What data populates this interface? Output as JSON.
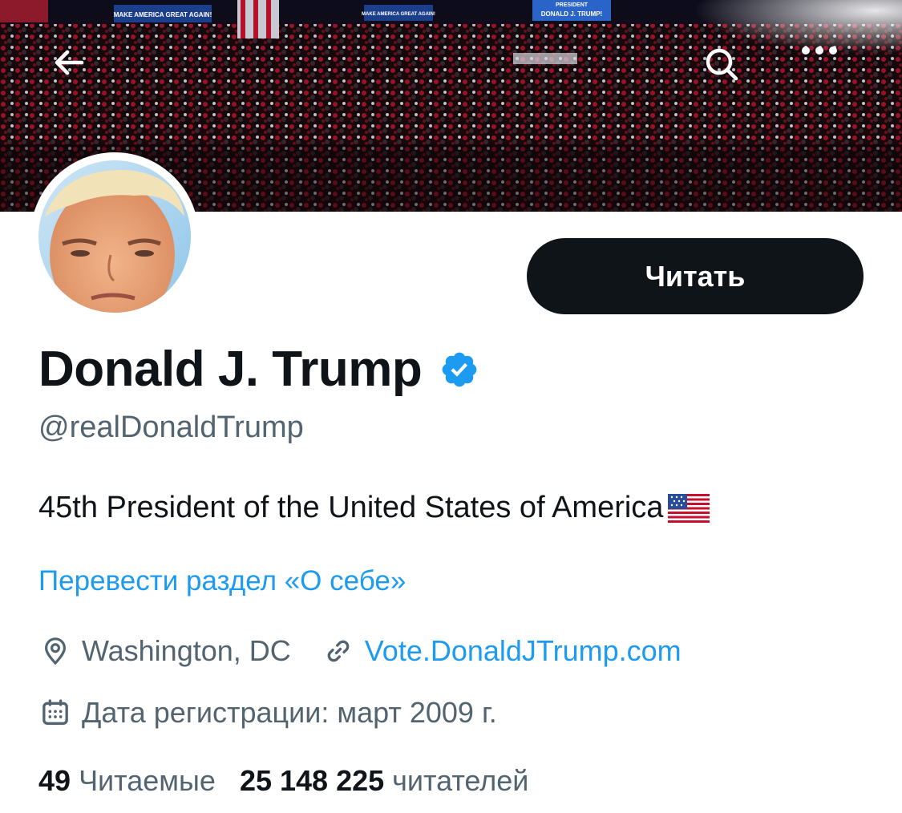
{
  "header": {
    "back_icon": "arrow-left-icon",
    "search_icon": "search-icon",
    "more_icon": "more-horizontal-icon",
    "banner_signs": [
      "MAKE AMERICA GREAT AGAIN!",
      "MAKE AMERICA GREAT AGAIN!",
      "PRESIDENT",
      "DONALD J. TRUMP!"
    ]
  },
  "profile": {
    "follow_label": "Читать",
    "display_name": "Donald J. Trump",
    "handle": "@realDonaldTrump",
    "bio": "45th President of the United States of America",
    "bio_emoji": "flag-us",
    "translate_label": "Перевести раздел «О себе»",
    "location": "Washington, DC",
    "website": "Vote.DonaldJTrump.com",
    "joined": "Дата регистрации: март 2009 г."
  },
  "stats": {
    "following_count": "49",
    "following_label": "Читаемые",
    "followers_count": "25 148 225",
    "followers_label": "читателей"
  },
  "colors": {
    "accent": "#1d9bf0",
    "text_primary": "#0f1419",
    "text_secondary": "#536471",
    "button_bg": "#0f1419"
  }
}
